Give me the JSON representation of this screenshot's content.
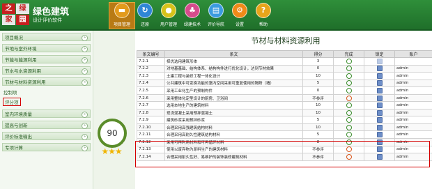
{
  "app": {
    "logo_chars": [
      "之",
      "绿",
      "家",
      "园"
    ],
    "title": "绿色建筑",
    "subtitle": "设计评价软件"
  },
  "toolbar": [
    {
      "label": "项目管理",
      "icon": "folder-icon",
      "color": "#e29a1c",
      "active": true
    },
    {
      "label": "还原",
      "icon": "refresh-icon",
      "color": "#2f86d6"
    },
    {
      "label": "用户管理",
      "icon": "user-icon",
      "color": "#d6c21a"
    },
    {
      "label": "绿建技术",
      "icon": "tech-icon",
      "color": "#d64b8c"
    },
    {
      "label": "评价导航",
      "icon": "navigation-icon",
      "color": "#3b9be0"
    },
    {
      "label": "设置",
      "icon": "gear-icon",
      "color": "#f08a18"
    },
    {
      "label": "帮助",
      "icon": "help-icon",
      "color": "#e8a51b"
    }
  ],
  "sidebar": {
    "items": [
      "项目概况",
      "节地与室外环境",
      "节能与能源利用",
      "节水与水资源利用",
      "节材与材料资源利用",
      "室内环境质量",
      "提高与创新",
      "评价标准输出",
      "专项计算"
    ],
    "subitems": [
      "控制项",
      "评分项"
    ]
  },
  "score": {
    "value": "90",
    "stars": "★★★"
  },
  "panel": {
    "title": "节材与材料资源利用"
  },
  "table": {
    "headers": [
      "条文编号",
      "条文",
      "得分",
      "完成",
      "锁定",
      "账户"
    ],
    "rows": [
      {
        "id": "7.2.1",
        "text": "择优选用建筑形体",
        "score": "3",
        "done": "green",
        "lock": false,
        "user": ""
      },
      {
        "id": "7.2.2",
        "text": "对地基基础、结构体系、结构构件进行优化设计，达到节材效果",
        "score": "0",
        "done": "green",
        "lock": true,
        "user": "admin"
      },
      {
        "id": "7.2.3",
        "text": "土建工程与装修工程一体化设计",
        "score": "10",
        "done": "green",
        "lock": true,
        "user": "admin"
      },
      {
        "id": "7.2.4",
        "text": "公共建筑中可变换功能的室内空间采用可重复使用的隔断（墙）",
        "score": "5",
        "done": "green",
        "lock": true,
        "user": "admin"
      },
      {
        "id": "7.2.5",
        "text": "采用工业化生产的预制构件",
        "score": "0",
        "done": "green",
        "lock": true,
        "user": "admin"
      },
      {
        "id": "7.2.6",
        "text": "采用整体化定型设计的厨房、卫浴间",
        "score": "不参评",
        "done": "red",
        "lock": true,
        "user": "admin"
      },
      {
        "id": "7.2.7",
        "text": "选用本地生产的建筑材料",
        "score": "10",
        "done": "green",
        "lock": true,
        "user": "admin"
      },
      {
        "id": "7.2.8",
        "text": "现浇混凝土采用预拌混凝土",
        "score": "10",
        "done": "green",
        "lock": true,
        "user": "admin"
      },
      {
        "id": "7.2.9",
        "text": "建筑砂浆采用预拌砂浆",
        "score": "5",
        "done": "green",
        "lock": true,
        "user": "admin"
      },
      {
        "id": "7.2.10",
        "text": "合理采用高强建筑结构材料",
        "score": "10",
        "done": "green",
        "lock": true,
        "user": "admin"
      },
      {
        "id": "7.2.11",
        "text": "合理采用高耐久性建筑结构材料",
        "score": "5",
        "done": "green",
        "lock": true,
        "user": "admin"
      },
      {
        "id": "7.2.12",
        "text": "采用可再利用材料和可再循环材料",
        "score": "8",
        "done": "green",
        "lock": true,
        "user": "admin"
      },
      {
        "id": "7.2.13",
        "text": "使用以废弃物为原料生产的建筑材料",
        "score": "不参评",
        "done": "red",
        "lock": true,
        "user": "admin"
      },
      {
        "id": "7.2.14",
        "text": "合理采用耐久性好、易维护的装饰装修建筑材料",
        "score": "不参评",
        "done": "red",
        "lock": true,
        "user": "admin"
      }
    ]
  }
}
